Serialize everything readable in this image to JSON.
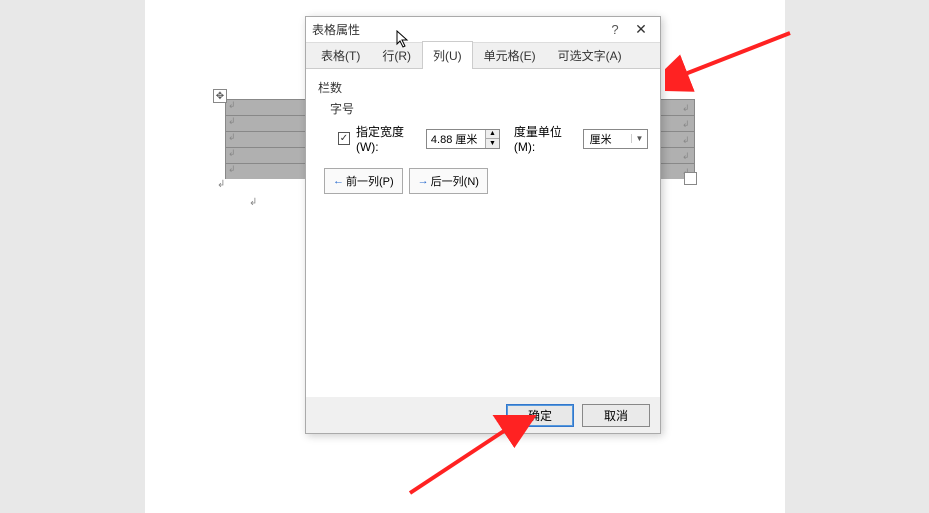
{
  "dialog": {
    "title": "表格属性",
    "tabs": {
      "table": "表格(T)",
      "row": "行(R)",
      "column": "列(U)",
      "cell": "单元格(E)",
      "alt": "可选文字(A)"
    },
    "column_panel": {
      "group": "栏数",
      "subgroup": "字号",
      "specify_width_label": "指定宽度(W):",
      "width_value": "4.88 厘米",
      "unit_label": "度量单位(M):",
      "unit_value": "厘米",
      "prev_col": "前一列(P)",
      "next_col": "后一列(N)"
    },
    "buttons": {
      "ok": "确定",
      "cancel": "取消"
    }
  }
}
